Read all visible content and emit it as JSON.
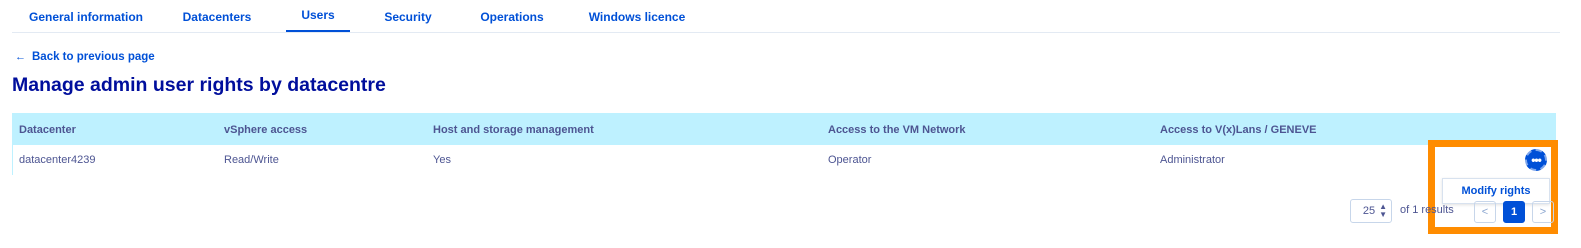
{
  "tabs": [
    {
      "label": "General information"
    },
    {
      "label": "Datacenters"
    },
    {
      "label": "Users"
    },
    {
      "label": "Security"
    },
    {
      "label": "Operations"
    },
    {
      "label": "Windows licence"
    }
  ],
  "active_tab": "Users",
  "back_link": {
    "label": "Back to previous page",
    "icon": "arrow-left-icon"
  },
  "page_title": "Manage admin user rights by datacentre",
  "table": {
    "columns": [
      "Datacenter",
      "vSphere access",
      "Host and storage management",
      "Access to the VM Network",
      "Access to V(x)Lans / GENEVE"
    ],
    "rows": [
      {
        "datacenter": "datacenter4239",
        "vsphere": "Read/Write",
        "host_storage": "Yes",
        "vm_network": "Operator",
        "vxlan": "Administrator"
      }
    ]
  },
  "row_actions": {
    "icon": "more-horizontal-icon",
    "glyph": "•••",
    "menu_items": [
      "Modify rights"
    ]
  },
  "pagination": {
    "page_size": "25",
    "results_text": "of 1 results",
    "current_page": "1",
    "prev_icon": "chevron-left-icon",
    "next_icon": "chevron-right-icon",
    "prev_glyph": "<",
    "next_glyph": ">"
  },
  "colors": {
    "accent": "#0050d7",
    "title": "#000e9c",
    "table_header_bg": "#bef1ff",
    "highlight": "#ff8c00"
  }
}
